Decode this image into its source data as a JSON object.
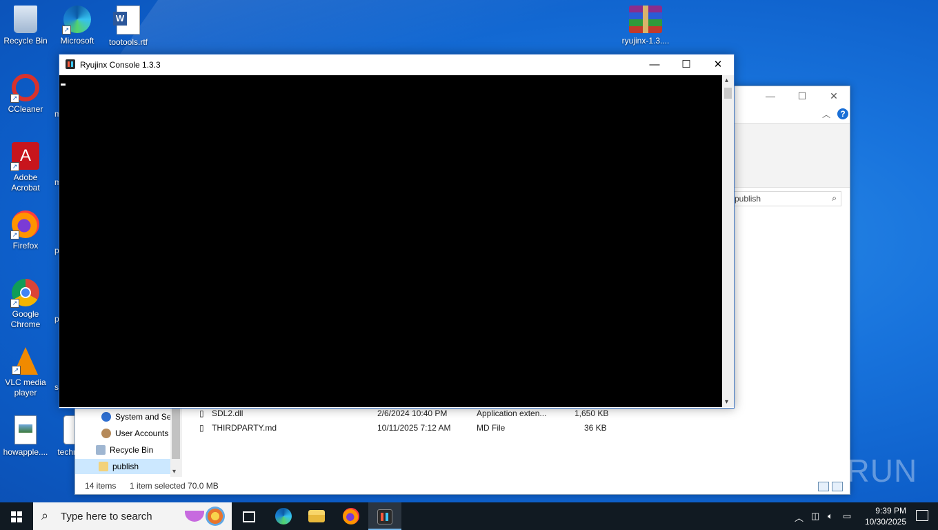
{
  "desktop": {
    "icons": [
      {
        "label": "Recycle Bin"
      },
      {
        "label": "Microsoft Edge"
      },
      {
        "label": "tootools.rtf"
      },
      {
        "label": "ryujinx-1.3...."
      },
      {
        "label": "CCleaner"
      },
      {
        "label": "Adobe Acrobat"
      },
      {
        "label": "Firefox"
      },
      {
        "label": "Google Chrome"
      },
      {
        "label": "VLC media player"
      },
      {
        "label": "howapple...."
      },
      {
        "label": "techn"
      }
    ],
    "cut_labels": [
      "m",
      "m",
      "p",
      "p",
      "sl"
    ]
  },
  "console": {
    "title": "Ryujinx Console 1.3.3",
    "colors": {
      "screen": "#000000",
      "cursor": "#ffffff"
    }
  },
  "explorer": {
    "search_placeholder": "publish",
    "nav_items": [
      {
        "label": "System and Se"
      },
      {
        "label": "User Accounts"
      },
      {
        "label": "Recycle Bin"
      },
      {
        "label": "publish",
        "selected": true
      }
    ],
    "files": [
      {
        "name": "SDL2.dll",
        "date": "2/6/2024 10:40 PM",
        "type": "Application exten...",
        "size": "1,650 KB"
      },
      {
        "name": "THIRDPARTY.md",
        "date": "10/11/2025 7:12 AM",
        "type": "MD File",
        "size": "36 KB"
      }
    ],
    "status": {
      "items": "14 items",
      "selected": "1 item selected  70.0 MB"
    }
  },
  "watermark": "ANY RUN",
  "taskbar": {
    "search_placeholder": "Type here to search",
    "apps": [
      "task-view",
      "edge",
      "file-explorer",
      "firefox",
      "ryujinx"
    ],
    "clock_time": "9:39 PM",
    "clock_date": "10/30/2025"
  }
}
